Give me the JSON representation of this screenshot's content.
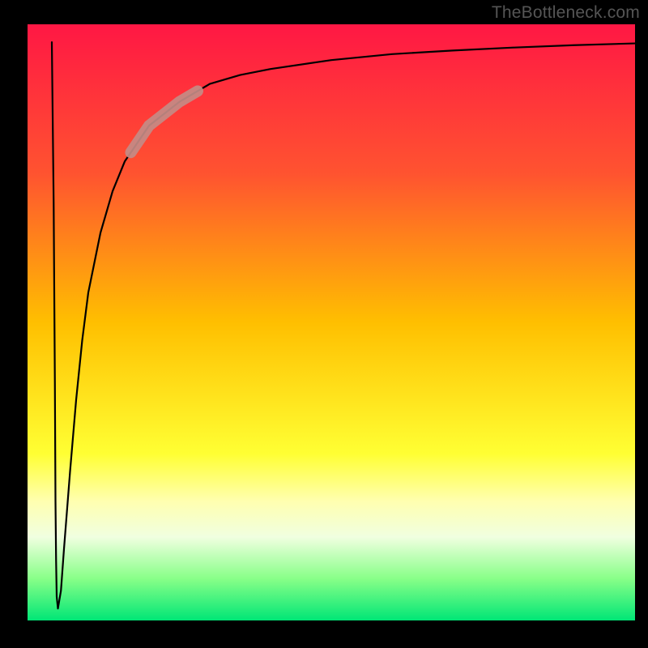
{
  "watermark": "TheBottleneck.com",
  "chart_data": {
    "type": "line",
    "title": "",
    "xlabel": "",
    "ylabel": "",
    "xlim": [
      0,
      100
    ],
    "ylim": [
      0,
      100
    ],
    "background_gradient": {
      "stops": [
        {
          "offset": 0.0,
          "color": "#ff1744"
        },
        {
          "offset": 0.25,
          "color": "#ff5330"
        },
        {
          "offset": 0.5,
          "color": "#ffbf00"
        },
        {
          "offset": 0.72,
          "color": "#ffff33"
        },
        {
          "offset": 0.8,
          "color": "#ffffb0"
        },
        {
          "offset": 0.86,
          "color": "#f0ffe0"
        },
        {
          "offset": 0.93,
          "color": "#88ff88"
        },
        {
          "offset": 1.0,
          "color": "#00e676"
        }
      ]
    },
    "margin_color": "#000000",
    "highlight": {
      "color": "#c48b86",
      "x_range": [
        17,
        28
      ],
      "y_range": [
        80,
        87
      ]
    },
    "series": [
      {
        "name": "curve",
        "color": "#000000",
        "x": [
          4,
          4.3,
          4.5,
          4.6,
          4.7,
          4.8,
          5,
          5.5,
          6,
          7,
          8,
          9,
          10,
          12,
          14,
          16,
          18,
          20,
          25,
          30,
          35,
          40,
          50,
          60,
          70,
          80,
          90,
          100
        ],
        "y": [
          97,
          70,
          40,
          20,
          10,
          4,
          2,
          5,
          12,
          25,
          37,
          47,
          55,
          65,
          72,
          77,
          80,
          83,
          87,
          90,
          91.5,
          92.5,
          94,
          95,
          95.6,
          96.1,
          96.5,
          96.8
        ]
      }
    ]
  }
}
